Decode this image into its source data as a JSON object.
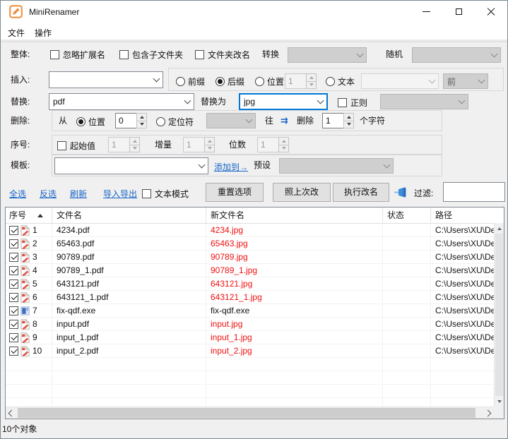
{
  "window": {
    "title": "MiniRenamer",
    "status": "10个对象"
  },
  "menu": {
    "file": "文件",
    "action": "操作"
  },
  "form": {
    "overall": {
      "label": "整体:",
      "ignore_ext": "忽略扩展名",
      "include_sub": "包含子文件夹",
      "folder_rename": "文件夹改名",
      "convert": "转换",
      "random": "随机"
    },
    "insert": {
      "label": "插入:",
      "prefix": "前缀",
      "suffix": "后缀",
      "position": "位置",
      "position_value": "1",
      "text": "文本",
      "front_value": "前"
    },
    "replace": {
      "label": "替换:",
      "find_value": "pdf",
      "with_label": "替换为",
      "with_value": "jpg",
      "regex": "正则"
    },
    "del": {
      "label": "删除:",
      "from": "从",
      "position": "位置",
      "position_value": "0",
      "anchor": "定位符",
      "toward": "往",
      "arrow": "⇉",
      "delete_word": "删除",
      "count_value": "1",
      "chars": "个字符"
    },
    "seq": {
      "label": "序号:",
      "start": "起始值",
      "start_value": "1",
      "increment": "增量",
      "increment_value": "1",
      "digits": "位数",
      "digits_value": "1"
    },
    "template": {
      "label": "模板:",
      "add_to": "添加到→",
      "preset": "预设"
    }
  },
  "toolbar": {
    "select_all": "全选",
    "invert": "反选",
    "refresh": "刷新",
    "import_export": "导入导出",
    "text_mode": "文本模式",
    "reset": "重置选项",
    "redo_last": "照上次改",
    "execute": "执行改名",
    "filter_label": "过滤:",
    "filter_value": ""
  },
  "table": {
    "headers": [
      "序号",
      "文件名",
      "新文件名",
      "状态",
      "路径"
    ],
    "rows": [
      {
        "num": "1",
        "icon": "pdf",
        "name": "4234.pdf",
        "new_name": "4234.jpg",
        "changed": true,
        "status": "",
        "path": "C:\\Users\\XU\\Des"
      },
      {
        "num": "2",
        "icon": "pdf",
        "name": "65463.pdf",
        "new_name": "65463.jpg",
        "changed": true,
        "status": "",
        "path": "C:\\Users\\XU\\Des"
      },
      {
        "num": "3",
        "icon": "pdf",
        "name": "90789.pdf",
        "new_name": "90789.jpg",
        "changed": true,
        "status": "",
        "path": "C:\\Users\\XU\\Des"
      },
      {
        "num": "4",
        "icon": "pdf",
        "name": "90789_1.pdf",
        "new_name": "90789_1.jpg",
        "changed": true,
        "status": "",
        "path": "C:\\Users\\XU\\Des"
      },
      {
        "num": "5",
        "icon": "pdf",
        "name": "643121.pdf",
        "new_name": "643121.jpg",
        "changed": true,
        "status": "",
        "path": "C:\\Users\\XU\\Des"
      },
      {
        "num": "6",
        "icon": "pdf",
        "name": "643121_1.pdf",
        "new_name": "643121_1.jpg",
        "changed": true,
        "status": "",
        "path": "C:\\Users\\XU\\Des"
      },
      {
        "num": "7",
        "icon": "exe",
        "name": "fix-qdf.exe",
        "new_name": "fix-qdf.exe",
        "changed": false,
        "status": "",
        "path": "C:\\Users\\XU\\Des"
      },
      {
        "num": "8",
        "icon": "pdf",
        "name": "input.pdf",
        "new_name": "input.jpg",
        "changed": true,
        "status": "",
        "path": "C:\\Users\\XU\\Des"
      },
      {
        "num": "9",
        "icon": "pdf",
        "name": "input_1.pdf",
        "new_name": "input_1.jpg",
        "changed": true,
        "status": "",
        "path": "C:\\Users\\XU\\Des"
      },
      {
        "num": "10",
        "icon": "pdf",
        "name": "input_2.pdf",
        "new_name": "input_2.jpg",
        "changed": true,
        "status": "",
        "path": "C:\\Users\\XU\\Des"
      }
    ]
  },
  "colors": {
    "accent_blue": "#0078d7",
    "changed_red": "#ee1111",
    "link_blue": "#1663c7",
    "icon_orange": "#ed8d3e",
    "pin_blue": "#3e8ddd"
  }
}
